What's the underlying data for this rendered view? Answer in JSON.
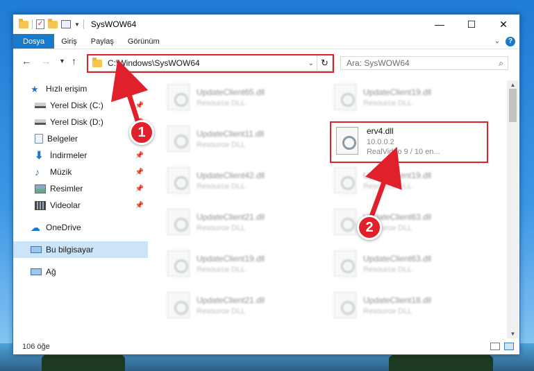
{
  "window": {
    "title": "SysWOW64",
    "controls": {
      "minimize": "—",
      "maximize": "☐",
      "close": "✕"
    }
  },
  "ribbon": {
    "tabs": [
      "Dosya",
      "Giriş",
      "Paylaş",
      "Görünüm"
    ]
  },
  "address": {
    "path": "C:\\Windows\\SysWOW64",
    "refresh_glyph": "↻"
  },
  "search": {
    "placeholder": "Ara: SysWOW64"
  },
  "sidebar": {
    "items": [
      {
        "label": "Hızlı erişim",
        "icon": "star-icon",
        "pinned": false
      },
      {
        "label": "Yerel Disk (C:)",
        "icon": "drive-icon",
        "pinned": true
      },
      {
        "label": "Yerel Disk (D:)",
        "icon": "drive-icon",
        "pinned": true
      },
      {
        "label": "Belgeler",
        "icon": "documents-icon",
        "pinned": true
      },
      {
        "label": "İndirmeler",
        "icon": "downloads-icon",
        "pinned": true
      },
      {
        "label": "Müzik",
        "icon": "music-icon",
        "pinned": true
      },
      {
        "label": "Resimler",
        "icon": "pictures-icon",
        "pinned": true
      },
      {
        "label": "Videolar",
        "icon": "videos-icon",
        "pinned": true
      },
      {
        "label": "OneDrive",
        "icon": "cloud-icon",
        "pinned": false
      },
      {
        "label": "Bu bilgisayar",
        "icon": "computer-icon",
        "pinned": false,
        "selected": true
      },
      {
        "label": "Ağ",
        "icon": "network-icon",
        "pinned": false
      }
    ]
  },
  "files": {
    "left_column": [
      {
        "name": "UpdateClient65.dll",
        "desc": "Resource DLL"
      },
      {
        "name": "UpdateClient11.dll",
        "desc": "Resource DLL"
      },
      {
        "name": "UpdateClient42.dll",
        "desc": "Resource DLL"
      },
      {
        "name": "UpdateClient21.dll",
        "desc": "Resource DLL"
      },
      {
        "name": "UpdateClient19.dll",
        "desc": "Resource DLL"
      },
      {
        "name": "UpdateClient21.dll",
        "desc": "Resource DLL"
      }
    ],
    "right_column": [
      {
        "name": "UpdateClient19.dll",
        "desc": "Resource DLL"
      },
      {
        "name": "UpdateClient19.dll",
        "desc": "Resource DLL"
      },
      {
        "name": "UpdateClient63.dll",
        "desc": "Resource DLL"
      },
      {
        "name": "UpdateClient63.dll",
        "desc": "Resource DLL"
      },
      {
        "name": "UpdateClient18.dll",
        "desc": "Resource DLL"
      }
    ],
    "highlighted": {
      "name": "erv4.dll",
      "version": "10.0.0.2",
      "desc": "RealVideo 9 / 10 en..."
    }
  },
  "status": {
    "item_count": "106 öğe"
  },
  "callouts": [
    "1",
    "2"
  ],
  "colors": {
    "accent": "#1979ca",
    "highlight": "#e0202a"
  }
}
